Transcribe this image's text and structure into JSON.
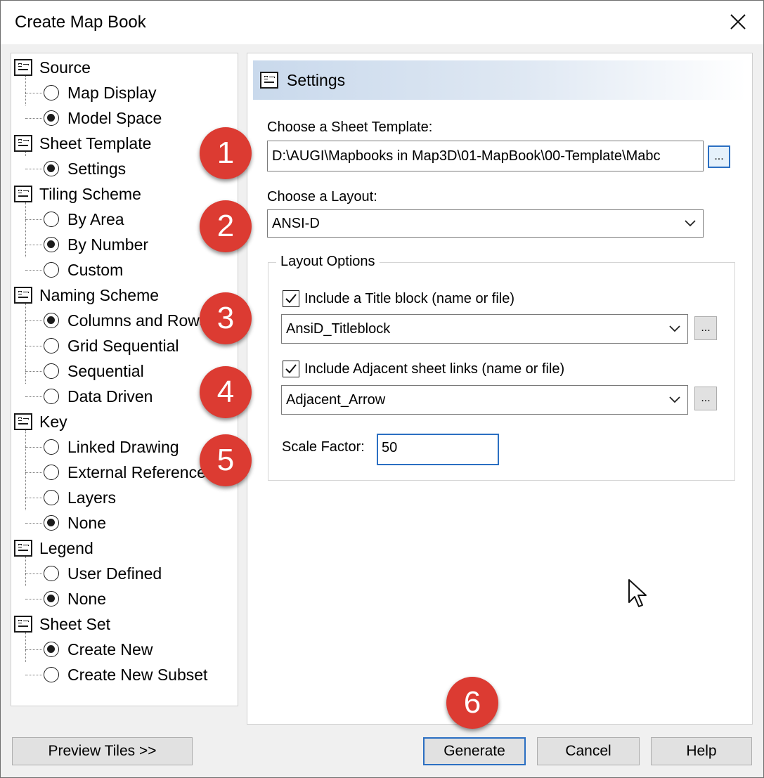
{
  "window": {
    "title": "Create Map Book"
  },
  "tree": {
    "groups": [
      {
        "label": "Source",
        "options": [
          {
            "label": "Map Display",
            "selected": false
          },
          {
            "label": "Model Space",
            "selected": true
          }
        ]
      },
      {
        "label": "Sheet Template",
        "options": [
          {
            "label": "Settings",
            "selected": true
          }
        ]
      },
      {
        "label": "Tiling Scheme",
        "options": [
          {
            "label": "By Area",
            "selected": false
          },
          {
            "label": "By Number",
            "selected": true
          },
          {
            "label": "Custom",
            "selected": false
          }
        ]
      },
      {
        "label": "Naming Scheme",
        "options": [
          {
            "label": "Columns and Rows",
            "selected": true
          },
          {
            "label": "Grid Sequential",
            "selected": false
          },
          {
            "label": "Sequential",
            "selected": false
          },
          {
            "label": "Data Driven",
            "selected": false
          }
        ]
      },
      {
        "label": "Key",
        "options": [
          {
            "label": "Linked Drawing",
            "selected": false
          },
          {
            "label": "External Reference",
            "selected": false
          },
          {
            "label": "Layers",
            "selected": false
          },
          {
            "label": "None",
            "selected": true
          }
        ]
      },
      {
        "label": "Legend",
        "options": [
          {
            "label": "User Defined",
            "selected": false
          },
          {
            "label": "None",
            "selected": true
          }
        ]
      },
      {
        "label": "Sheet Set",
        "options": [
          {
            "label": "Create New",
            "selected": true
          },
          {
            "label": "Create New Subset",
            "selected": false
          }
        ]
      }
    ]
  },
  "settings": {
    "header": "Settings",
    "sheet_template_label": "Choose a Sheet Template:",
    "sheet_template_value": "D:\\AUGI\\Mapbooks in Map3D\\01-MapBook\\00-Template\\Mabc",
    "browse_label": "...",
    "layout_label": "Choose a Layout:",
    "layout_value": "ANSI-D",
    "layout_options_title": "Layout Options",
    "title_block_label": "Include a Title block (name or file)",
    "title_block_checked": true,
    "title_block_value": "AnsiD_Titleblock",
    "adjacent_label": "Include Adjacent sheet links (name or file)",
    "adjacent_checked": true,
    "adjacent_value": "Adjacent_Arrow",
    "scale_factor_label": "Scale Factor:",
    "scale_factor_value": "50"
  },
  "callouts": [
    "1",
    "2",
    "3",
    "4",
    "5",
    "6"
  ],
  "buttons": {
    "preview": "Preview Tiles >>",
    "generate": "Generate",
    "cancel": "Cancel",
    "help": "Help"
  },
  "colors": {
    "callout": "#dc3b32",
    "focus": "#2b6fc2"
  }
}
